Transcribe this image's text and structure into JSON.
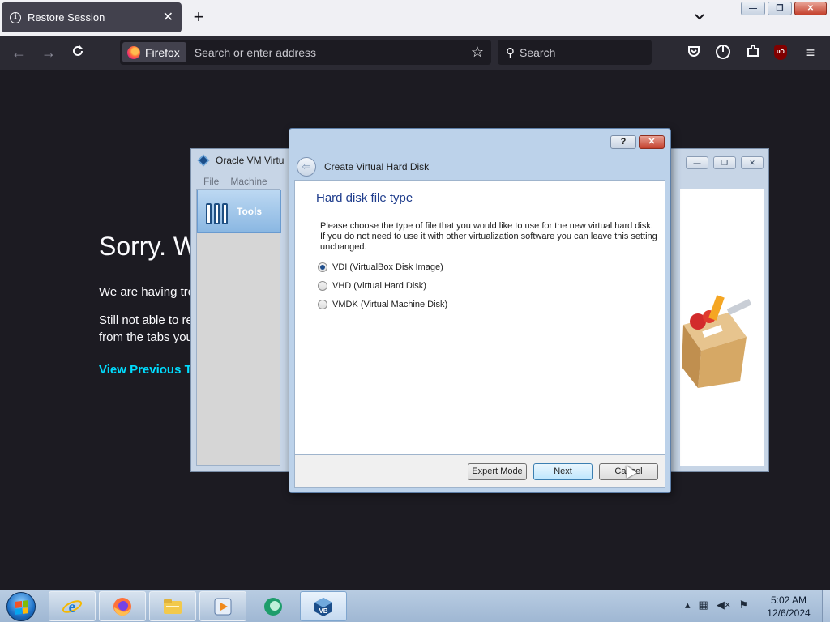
{
  "browser": {
    "tab_title": "Restore Session",
    "tab_close": "✕",
    "new_tab": "+",
    "chip_label": "Firefox",
    "address_placeholder": "Search or enter address",
    "search_placeholder": "Search",
    "ublock_label": "uO"
  },
  "page": {
    "title": "Sorry. W",
    "line1": "We are having tro",
    "line2a": "Still not able to re",
    "line2b": "from the tabs you",
    "link": "View Previous Ta"
  },
  "vbox_manager": {
    "title": "Oracle VM Virtu",
    "menu": [
      "File",
      "Machine"
    ],
    "tools_label": "Tools"
  },
  "dialog": {
    "help": "?",
    "close": "✕",
    "back": "⇦",
    "title": "Create Virtual Hard Disk",
    "heading": "Hard disk file type",
    "description": "Please choose the type of file that you would like to use for the new virtual hard disk. If you do not need to use it with other virtualization software you can leave this setting unchanged.",
    "options": [
      {
        "label": "VDI (VirtualBox Disk Image)",
        "checked": true
      },
      {
        "label": "VHD (Virtual Hard Disk)",
        "checked": false
      },
      {
        "label": "VMDK (Virtual Machine Disk)",
        "checked": false
      }
    ],
    "buttons": {
      "expert": "Expert Mode",
      "next": "Next",
      "cancel": "Cancel"
    }
  },
  "taskbar": {
    "time": "5:02 AM",
    "date": "12/6/2024"
  },
  "colors": {
    "browser_bg": "#1c1b22",
    "link": "#00ddff",
    "dialog_heading": "#1e3c8c"
  }
}
